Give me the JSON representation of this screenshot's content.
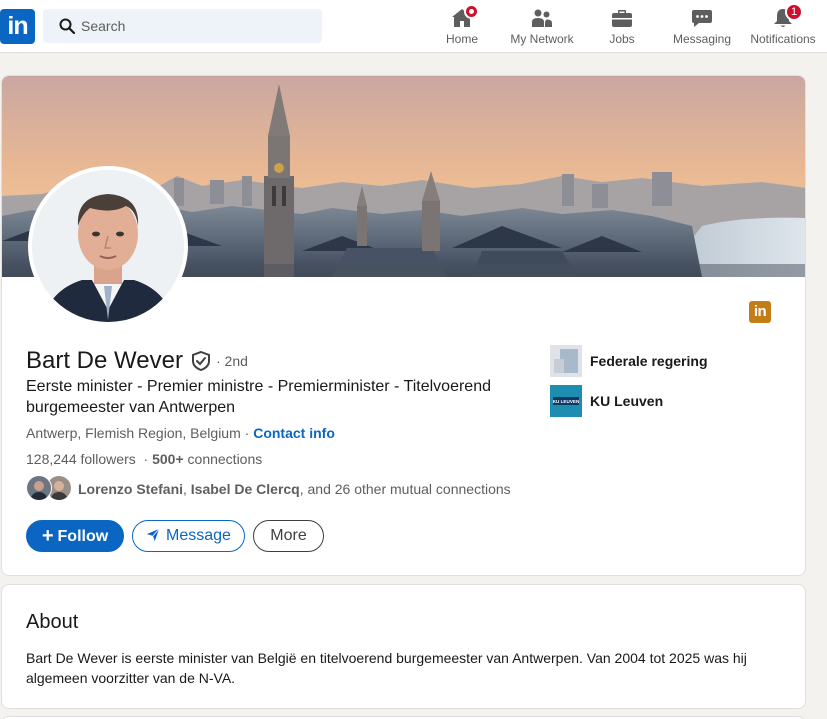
{
  "nav": {
    "logo_text": "in",
    "search_placeholder": "Search",
    "items": [
      {
        "label": "Home",
        "icon": "home-icon",
        "badge": ""
      },
      {
        "label": "My Network",
        "icon": "network-icon",
        "badge": ""
      },
      {
        "label": "Jobs",
        "icon": "briefcase-icon",
        "badge": ""
      },
      {
        "label": "Messaging",
        "icon": "chat-icon",
        "badge": ""
      },
      {
        "label": "Notifications",
        "icon": "bell-icon",
        "badge": "1"
      }
    ]
  },
  "profile": {
    "name": "Bart De Wever",
    "degree": "· 2nd",
    "headline": "Eerste minister - Premier ministre - Premierminister - Titelvoerend burgemeester van Antwerpen",
    "location": "Antwerp, Flemish Region, Belgium",
    "location_sep": " · ",
    "contact_info": "Contact info",
    "followers": "128,244 followers",
    "connections_sep": "  · ",
    "connections": "500+",
    "connections_suffix": " connections",
    "mutual": {
      "name1": "Lorenzo Stefani",
      "sep": ", ",
      "name2": "Isabel De Clercq",
      "rest": ", and 26 other mutual connections"
    },
    "buttons": {
      "follow": "Follow",
      "follow_prefix": "+",
      "message": "Message",
      "more": "More"
    },
    "orgs": [
      {
        "name": "Federale regering"
      },
      {
        "name": "KU Leuven",
        "logo_text": "KU LEUVEN"
      }
    ],
    "linkedin_badge": "in"
  },
  "about": {
    "title": "About",
    "text": "Bart De Wever is eerste minister van België en titelvoerend burgemeester van Antwerpen. Van 2004 tot 2025 was hij algemeen voorzitter van de N-VA."
  },
  "colors": {
    "brand": "#0a66c2",
    "badge": "#cb112d",
    "page_bg": "#f4f2ee"
  }
}
